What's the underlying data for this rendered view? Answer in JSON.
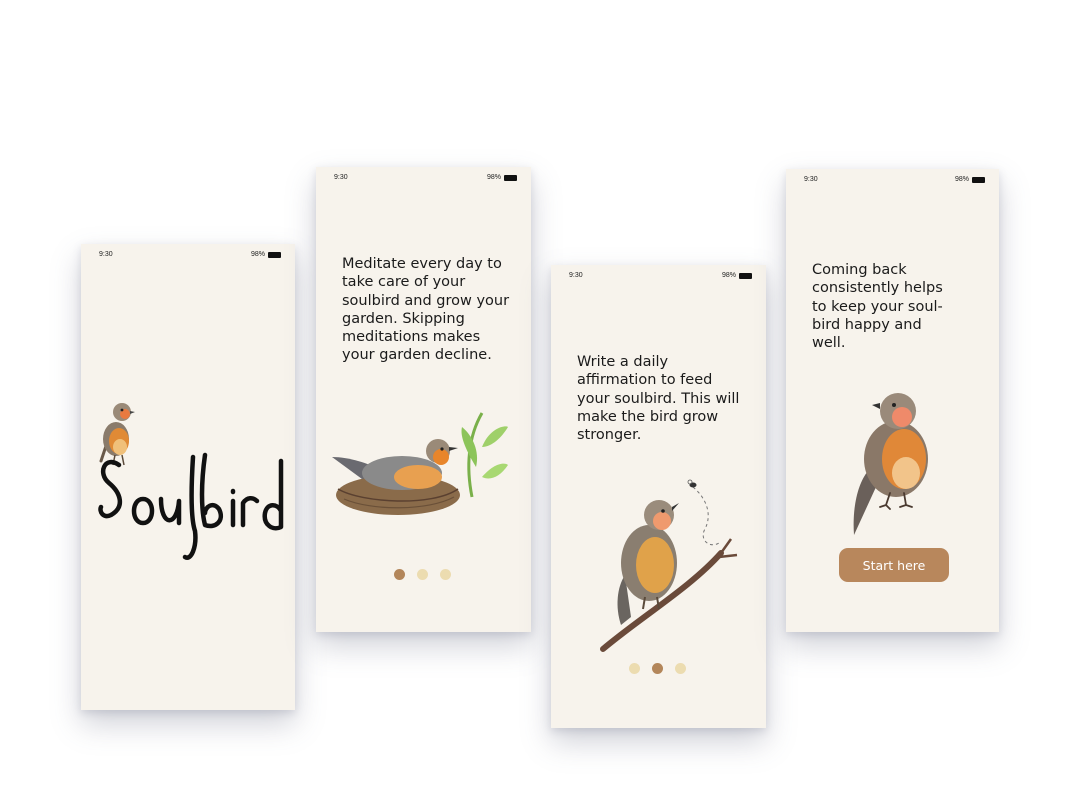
{
  "status_bar": {
    "time": "9:30",
    "battery": "98%"
  },
  "screens": [
    {
      "logo_text": "Soulbird",
      "bird_icon": "robin-bird-illustration"
    },
    {
      "text": "Meditate every day to take care of your soulbird and grow your garden. Skipping meditations makes your garden decline.",
      "illustration": "bird-in-nest-with-plant",
      "page_index": 0,
      "page_count": 3
    },
    {
      "text": "Write a daily affirmation to feed your soulbird. This will make the bird grow stronger.",
      "illustration": "bird-on-branch-with-bee",
      "page_index": 1,
      "page_count": 3
    },
    {
      "text": "Coming back consistently helps to keep your soul-bird happy and well.",
      "illustration": "standing-robin",
      "button_label": "Start here"
    }
  ],
  "colors": {
    "screen_bg": "#f7f3ec",
    "accent": "#b8875c",
    "dot_inactive": "#ecdcb0",
    "dot_active": "#b3865a"
  }
}
